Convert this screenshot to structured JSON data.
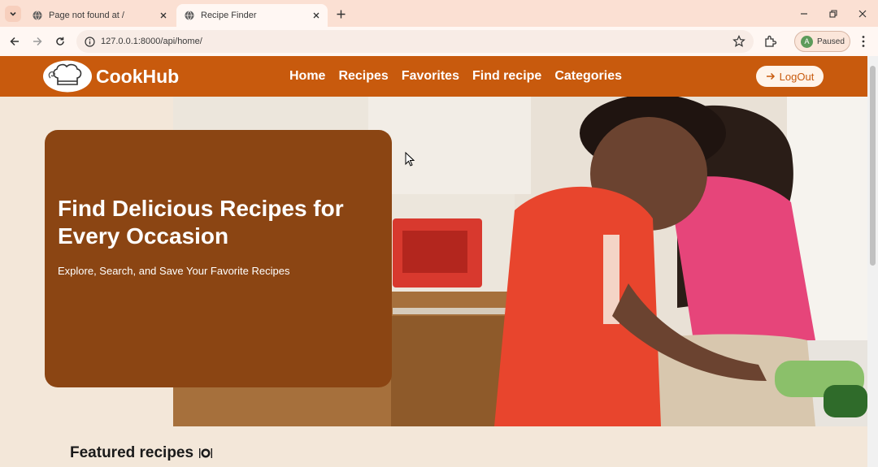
{
  "browser": {
    "tabs": [
      {
        "title": "Page not found at /",
        "active": false
      },
      {
        "title": "Recipe Finder",
        "active": true
      }
    ],
    "url": "127.0.0.1:8000/api/home/",
    "profile_status": "Paused",
    "profile_initial": "A"
  },
  "site": {
    "brand": "CookHub",
    "nav": [
      "Home",
      "Recipes",
      "Favorites",
      "Find recipe",
      "Categories"
    ],
    "logout_label": "LogOut",
    "colors": {
      "nav_bg": "#c85a0d",
      "hero_card": "#8b4513",
      "page_bg": "#f3e7d9"
    }
  },
  "hero": {
    "title": "Find Delicious Recipes for Every Occasion",
    "subtitle": "Explore, Search, and Save Your Favorite Recipes"
  },
  "featured": {
    "heading": "Featured recipes",
    "icon": "plate-cutlery-icon"
  }
}
